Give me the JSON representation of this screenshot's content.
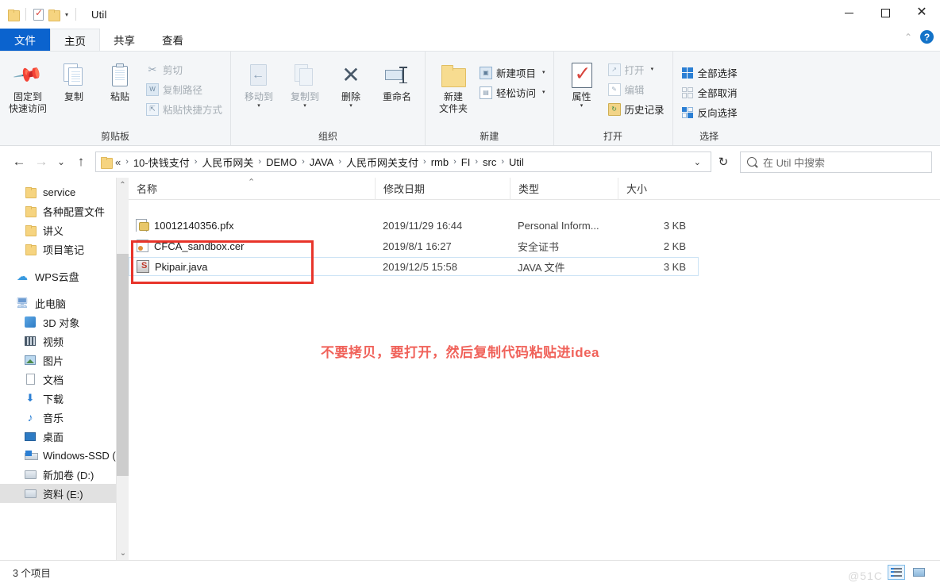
{
  "window": {
    "title": "Util",
    "quick_access": [
      "folder-icon",
      "properties-icon",
      "new-folder-icon"
    ],
    "controls": {
      "minimize": "—",
      "maximize": "□",
      "close": "✕"
    }
  },
  "ribbon": {
    "tabs": [
      {
        "label": "文件",
        "state": "file"
      },
      {
        "label": "主页",
        "state": "active"
      },
      {
        "label": "共享",
        "state": "normal"
      },
      {
        "label": "查看",
        "state": "normal"
      }
    ],
    "collapse_label": "⌃",
    "help_label": "?",
    "groups": [
      {
        "title": "剪贴板",
        "big_buttons": [
          {
            "label": "固定到\n快速访问",
            "icon": "pin-icon",
            "dim": false
          },
          {
            "label": "复制",
            "icon": "copy-icon",
            "dim": false
          },
          {
            "label": "粘贴",
            "icon": "paste-icon",
            "dim": false
          }
        ],
        "small_buttons": [
          {
            "label": "剪切",
            "icon": "scissors-icon",
            "dim": true
          },
          {
            "label": "复制路径",
            "icon": "copy-path-icon",
            "dim": true
          },
          {
            "label": "粘贴快捷方式",
            "icon": "paste-shortcut-icon",
            "dim": true
          }
        ]
      },
      {
        "title": "组织",
        "big_buttons": [
          {
            "label": "移动到",
            "icon": "move-to-icon",
            "dim": true,
            "caret": true
          },
          {
            "label": "复制到",
            "icon": "copy-to-icon",
            "dim": true,
            "caret": true
          },
          {
            "label": "删除",
            "icon": "delete-icon",
            "dim": false,
            "caret": true
          },
          {
            "label": "重命名",
            "icon": "rename-icon",
            "dim": false
          }
        ],
        "small_buttons": []
      },
      {
        "title": "新建",
        "big_buttons": [
          {
            "label": "新建\n文件夹",
            "icon": "new-folder-icon",
            "dim": false
          }
        ],
        "small_buttons": [
          {
            "label": "新建项目",
            "icon": "new-item-icon",
            "dim": false,
            "caret": true
          },
          {
            "label": "轻松访问",
            "icon": "easy-access-icon",
            "dim": false,
            "caret": true
          }
        ]
      },
      {
        "title": "打开",
        "big_buttons": [
          {
            "label": "属性",
            "icon": "properties-icon",
            "dim": false,
            "caret": true
          }
        ],
        "small_buttons": [
          {
            "label": "打开",
            "icon": "open-icon",
            "dim": true,
            "caret": true
          },
          {
            "label": "编辑",
            "icon": "edit-icon",
            "dim": true
          },
          {
            "label": "历史记录",
            "icon": "history-icon",
            "dim": false
          }
        ]
      },
      {
        "title": "选择",
        "big_buttons": [],
        "small_buttons": [
          {
            "label": "全部选择",
            "icon": "select-all-icon",
            "dim": false
          },
          {
            "label": "全部取消",
            "icon": "select-none-icon",
            "dim": false
          },
          {
            "label": "反向选择",
            "icon": "invert-selection-icon",
            "dim": false
          }
        ]
      }
    ]
  },
  "address_bar": {
    "back": "←",
    "forward": "→",
    "recent": "⌄",
    "up": "↑",
    "breadcrumb_prefix": "«",
    "breadcrumbs": [
      "10-快钱支付",
      "人民币网关",
      "DEMO",
      "JAVA",
      "人民币网关支付",
      "rmb",
      "FI",
      "src",
      "Util"
    ],
    "dropdown": "⌄",
    "refresh": "↻",
    "search_placeholder": "在 Util 中搜索"
  },
  "nav_pane": {
    "items": [
      {
        "label": "service",
        "icon": "folder-icon",
        "selected": false,
        "group": "folders"
      },
      {
        "label": "各种配置文件",
        "icon": "folder-icon",
        "selected": false,
        "group": "folders"
      },
      {
        "label": "讲义",
        "icon": "folder-icon",
        "selected": false,
        "group": "folders"
      },
      {
        "label": "项目笔记",
        "icon": "folder-icon",
        "selected": false,
        "group": "folders"
      },
      {
        "label": "WPS云盘",
        "icon": "cloud-icon",
        "selected": false,
        "group": "cloud"
      },
      {
        "label": "此电脑",
        "icon": "this-pc-icon",
        "selected": false,
        "group": "pc"
      },
      {
        "label": "3D 对象",
        "icon": "3d-objects-icon",
        "selected": false,
        "group": "pc"
      },
      {
        "label": "视频",
        "icon": "videos-icon",
        "selected": false,
        "group": "pc"
      },
      {
        "label": "图片",
        "icon": "pictures-icon",
        "selected": false,
        "group": "pc"
      },
      {
        "label": "文档",
        "icon": "documents-icon",
        "selected": false,
        "group": "pc"
      },
      {
        "label": "下载",
        "icon": "downloads-icon",
        "selected": false,
        "group": "pc"
      },
      {
        "label": "音乐",
        "icon": "music-icon",
        "selected": false,
        "group": "pc"
      },
      {
        "label": "桌面",
        "icon": "desktop-icon",
        "selected": false,
        "group": "pc"
      },
      {
        "label": "Windows-SSD (",
        "icon": "windows-drive-icon",
        "selected": false,
        "group": "pc"
      },
      {
        "label": "新加卷 (D:)",
        "icon": "drive-icon",
        "selected": false,
        "group": "pc"
      },
      {
        "label": "资料 (E:)",
        "icon": "drive-icon",
        "selected": true,
        "group": "pc"
      }
    ]
  },
  "file_list": {
    "columns": [
      {
        "label": "名称",
        "sorted": "asc"
      },
      {
        "label": "修改日期",
        "sorted": ""
      },
      {
        "label": "类型",
        "sorted": ""
      },
      {
        "label": "大小",
        "sorted": ""
      }
    ],
    "rows": [
      {
        "name": "10012140356.pfx",
        "date": "2019/11/29 16:44",
        "type": "Personal Inform...",
        "size": "3 KB",
        "icon": "pfx-file-icon",
        "selected": false
      },
      {
        "name": "CFCA_sandbox.cer",
        "date": "2019/8/1 16:27",
        "type": "安全证书",
        "size": "2 KB",
        "icon": "cer-file-icon",
        "selected": false
      },
      {
        "name": "Pkipair.java",
        "date": "2019/12/5 15:58",
        "type": "JAVA 文件",
        "size": "3 KB",
        "icon": "java-file-icon",
        "selected": true
      }
    ]
  },
  "annotations": {
    "note_text": "不要拷贝，要打开，然后复制代码粘贴进idea",
    "note_color": "#f0625a",
    "rect_color": "#e8342a"
  },
  "status_bar": {
    "item_count": "3 个项目",
    "watermark": "@51C",
    "view_buttons": [
      {
        "name": "details-view",
        "active": true
      },
      {
        "name": "thumbnail-view",
        "active": false
      }
    ]
  }
}
